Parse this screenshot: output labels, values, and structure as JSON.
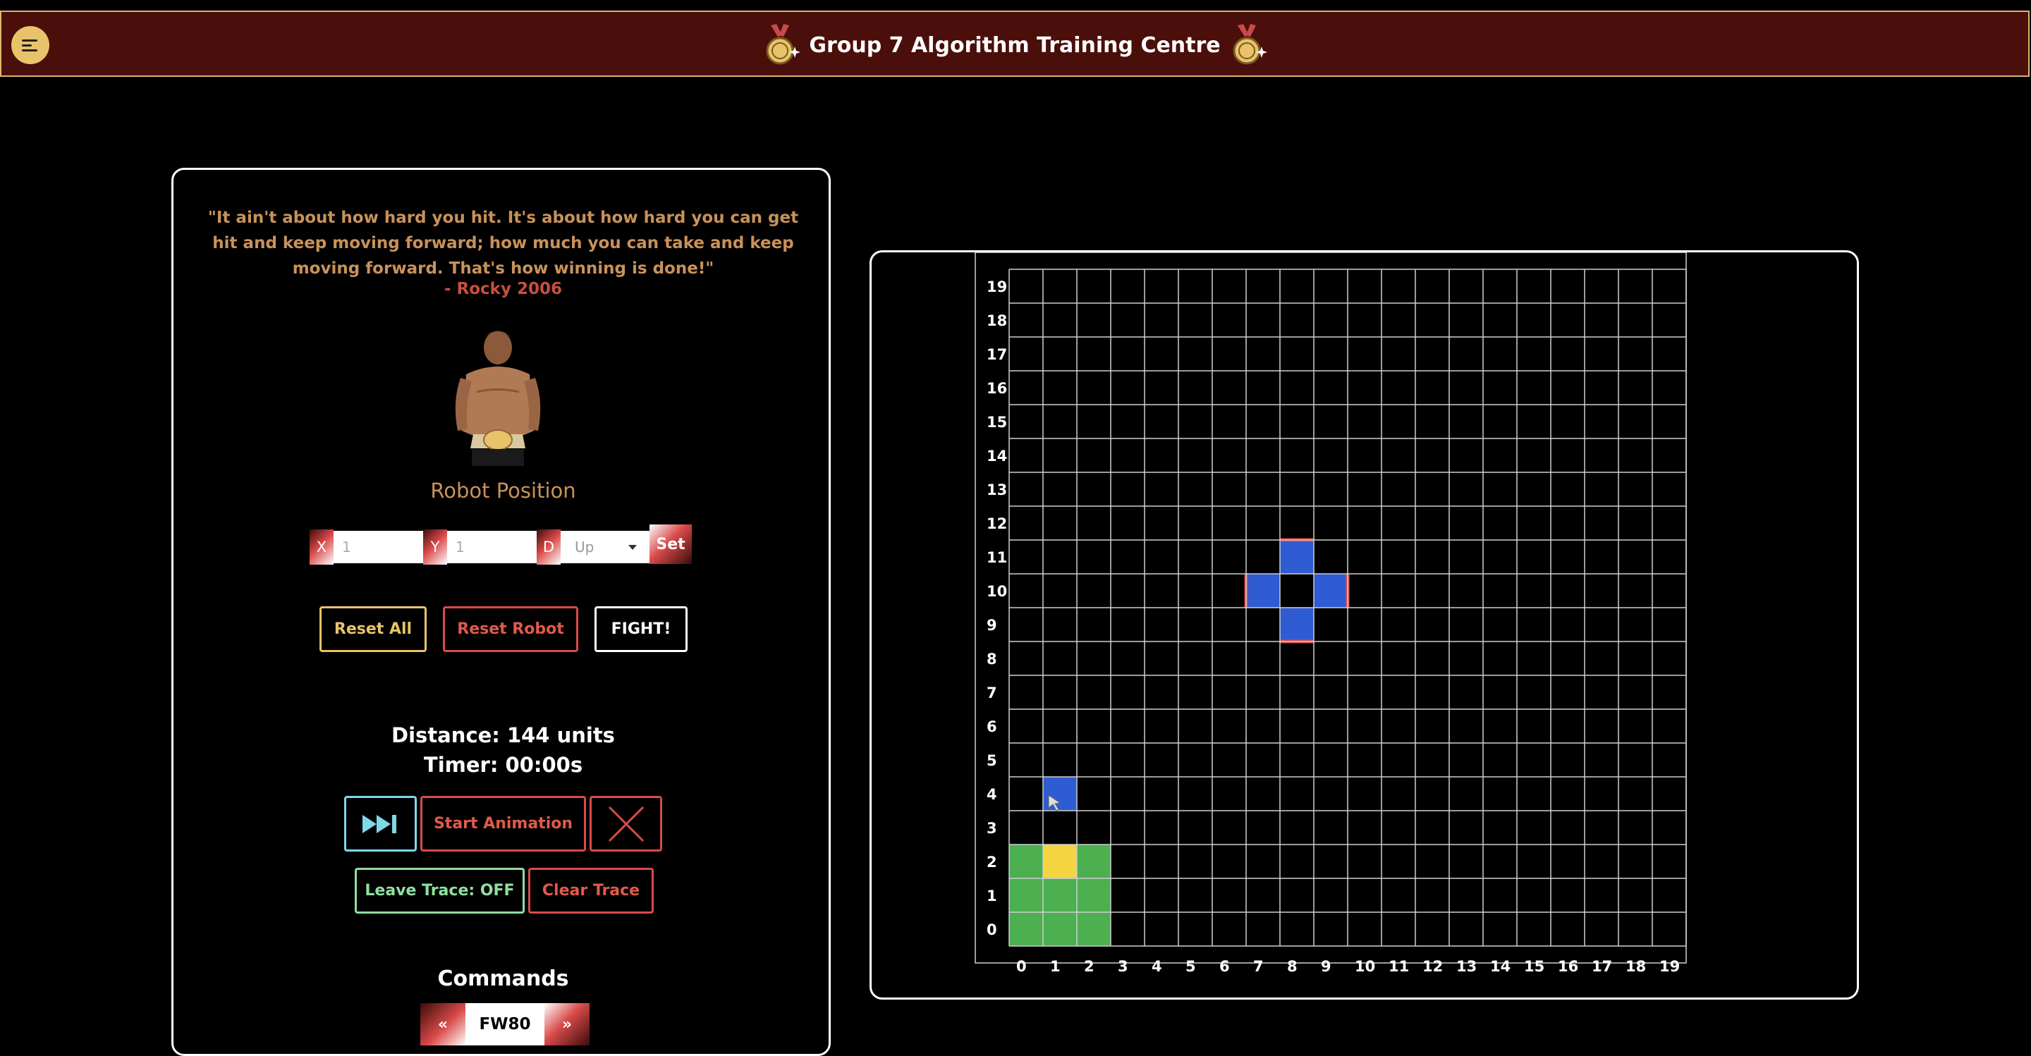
{
  "header": {
    "title": "Group 7 Algorithm Training Centre",
    "menu_icon": "menu-icon",
    "medal_icon": "medal-icon",
    "colors": {
      "bar": "#4a0e0b",
      "border": "#d9b86a"
    }
  },
  "left": {
    "quote": "\"It ain't about how hard you hit. It's about how hard you can get hit and keep moving forward; how much you can take and keep moving forward. That's how winning is done!\"",
    "author": "- Rocky 2006",
    "robot_position_title": "Robot Position",
    "x_label": "X",
    "y_label": "Y",
    "d_label": "D",
    "x_placeholder": "1",
    "y_placeholder": "1",
    "direction_selected": "Up",
    "set_label": "Set",
    "reset_all_label": "Reset All",
    "reset_robot_label": "Reset Robot",
    "fight_label": "FIGHT!",
    "distance": "Distance: 144 units",
    "timer": "Timer: 00:00s",
    "skip_icon": "fast-forward-icon",
    "start_animation_label": "Start Animation",
    "close_icon": "x-icon",
    "leave_trace_label": "Leave Trace: OFF",
    "clear_trace_label": "Clear Trace",
    "commands_title": "Commands",
    "prev_label": "«",
    "current_command": "FW80",
    "next_label": "»"
  },
  "grid": {
    "size": 20,
    "x_labels": [
      "0",
      "1",
      "2",
      "3",
      "4",
      "5",
      "6",
      "7",
      "8",
      "9",
      "10",
      "11",
      "12",
      "13",
      "14",
      "15",
      "16",
      "17",
      "18",
      "19"
    ],
    "y_labels": [
      "0",
      "1",
      "2",
      "3",
      "4",
      "5",
      "6",
      "7",
      "8",
      "9",
      "10",
      "11",
      "12",
      "13",
      "14",
      "15",
      "16",
      "17",
      "18",
      "19"
    ],
    "robot_cells": [
      [
        0,
        0
      ],
      [
        1,
        0
      ],
      [
        2,
        0
      ],
      [
        0,
        1
      ],
      [
        1,
        1
      ],
      [
        2,
        1
      ],
      [
        0,
        2
      ],
      [
        2,
        2
      ]
    ],
    "robot_head": [
      1,
      2
    ],
    "obstacles": [
      {
        "x": 8,
        "y": 11,
        "face": "top"
      },
      {
        "x": 7,
        "y": 10,
        "face": "left"
      },
      {
        "x": 9,
        "y": 10,
        "face": "right"
      },
      {
        "x": 8,
        "y": 9,
        "face": "bottom"
      },
      {
        "x": 1,
        "y": 4,
        "face": "none"
      }
    ],
    "colors": {
      "robot": "#4caf50",
      "head": "#f5d442",
      "obstacle": "#2f5bd3",
      "face": "#d94a4a",
      "line": "#cfcfcf"
    }
  }
}
